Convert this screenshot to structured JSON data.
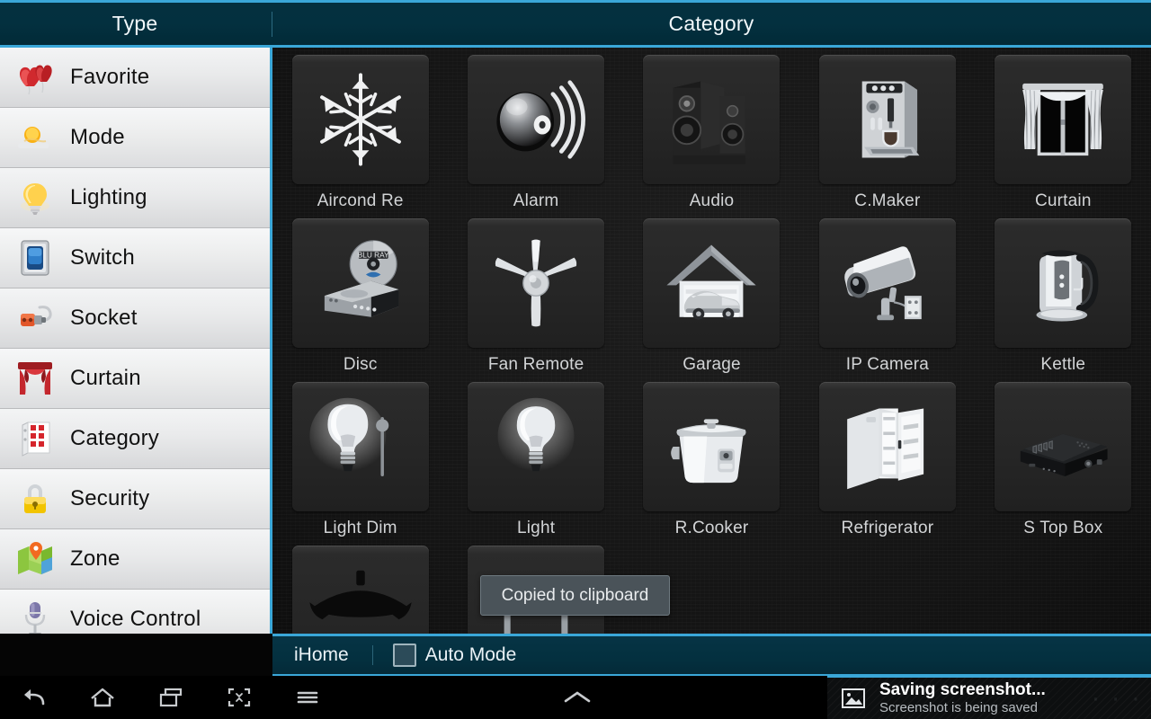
{
  "header": {
    "type_title": "Type",
    "category_title": "Category"
  },
  "sidebar": {
    "items": [
      {
        "label": "Favorite",
        "icon": "hearts-icon"
      },
      {
        "label": "Mode",
        "icon": "sun-cloud-icon"
      },
      {
        "label": "Lighting",
        "icon": "lightbulb-icon"
      },
      {
        "label": "Switch",
        "icon": "rocker-switch-icon"
      },
      {
        "label": "Socket",
        "icon": "power-plug-icon"
      },
      {
        "label": "Curtain",
        "icon": "curtain-icon"
      },
      {
        "label": "Category",
        "icon": "grid-rack-icon"
      },
      {
        "label": "Security",
        "icon": "padlock-icon"
      },
      {
        "label": "Zone",
        "icon": "map-pin-icon"
      },
      {
        "label": "Voice Control",
        "icon": "microphone-icon"
      }
    ]
  },
  "grid": {
    "items": [
      {
        "label": "Aircond Re",
        "icon": "snowflake-icon"
      },
      {
        "label": "Alarm",
        "icon": "alarm-bell-icon"
      },
      {
        "label": "Audio",
        "icon": "speakers-icon"
      },
      {
        "label": "C.Maker",
        "icon": "coffee-machine-icon"
      },
      {
        "label": "Curtain",
        "icon": "window-curtain-icon"
      },
      {
        "label": "Disc",
        "icon": "bluray-player-icon"
      },
      {
        "label": "Fan Remote",
        "icon": "ceiling-fan-icon"
      },
      {
        "label": "Garage",
        "icon": "garage-car-icon"
      },
      {
        "label": "IP Camera",
        "icon": "cctv-camera-icon"
      },
      {
        "label": "Kettle",
        "icon": "electric-kettle-icon"
      },
      {
        "label": "Light Dim",
        "icon": "bulb-dimmer-icon"
      },
      {
        "label": "Light",
        "icon": "bulb-icon"
      },
      {
        "label": "R.Cooker",
        "icon": "rice-cooker-icon"
      },
      {
        "label": "Refrigerator",
        "icon": "fridge-icon"
      },
      {
        "label": "S Top Box",
        "icon": "set-top-box-icon"
      },
      {
        "label": "",
        "icon": "lamp-shade-icon"
      },
      {
        "label": "",
        "icon": "table-icon"
      }
    ]
  },
  "toast": {
    "message": "Copied to clipboard"
  },
  "statusbar": {
    "app_name": "iHome",
    "auto_mode_label": "Auto Mode",
    "auto_mode_checked": false
  },
  "navbar": {
    "buttons": [
      {
        "name": "back",
        "icon": "back-arrow-icon"
      },
      {
        "name": "home",
        "icon": "home-icon"
      },
      {
        "name": "recents",
        "icon": "recents-icon"
      },
      {
        "name": "screenshot",
        "icon": "screenshot-icon"
      },
      {
        "name": "menu",
        "icon": "hamburger-menu-icon"
      }
    ],
    "expand_icon": "chevron-up-icon"
  },
  "notification": {
    "title": "Saving screenshot...",
    "subtitle": "Screenshot is being saved",
    "icon": "image-icon"
  },
  "colors": {
    "accent_blue": "#3aa7d8",
    "header_teal": "#04303f",
    "content_dark": "#161616",
    "sidebar_light": "#e9eaeb"
  }
}
